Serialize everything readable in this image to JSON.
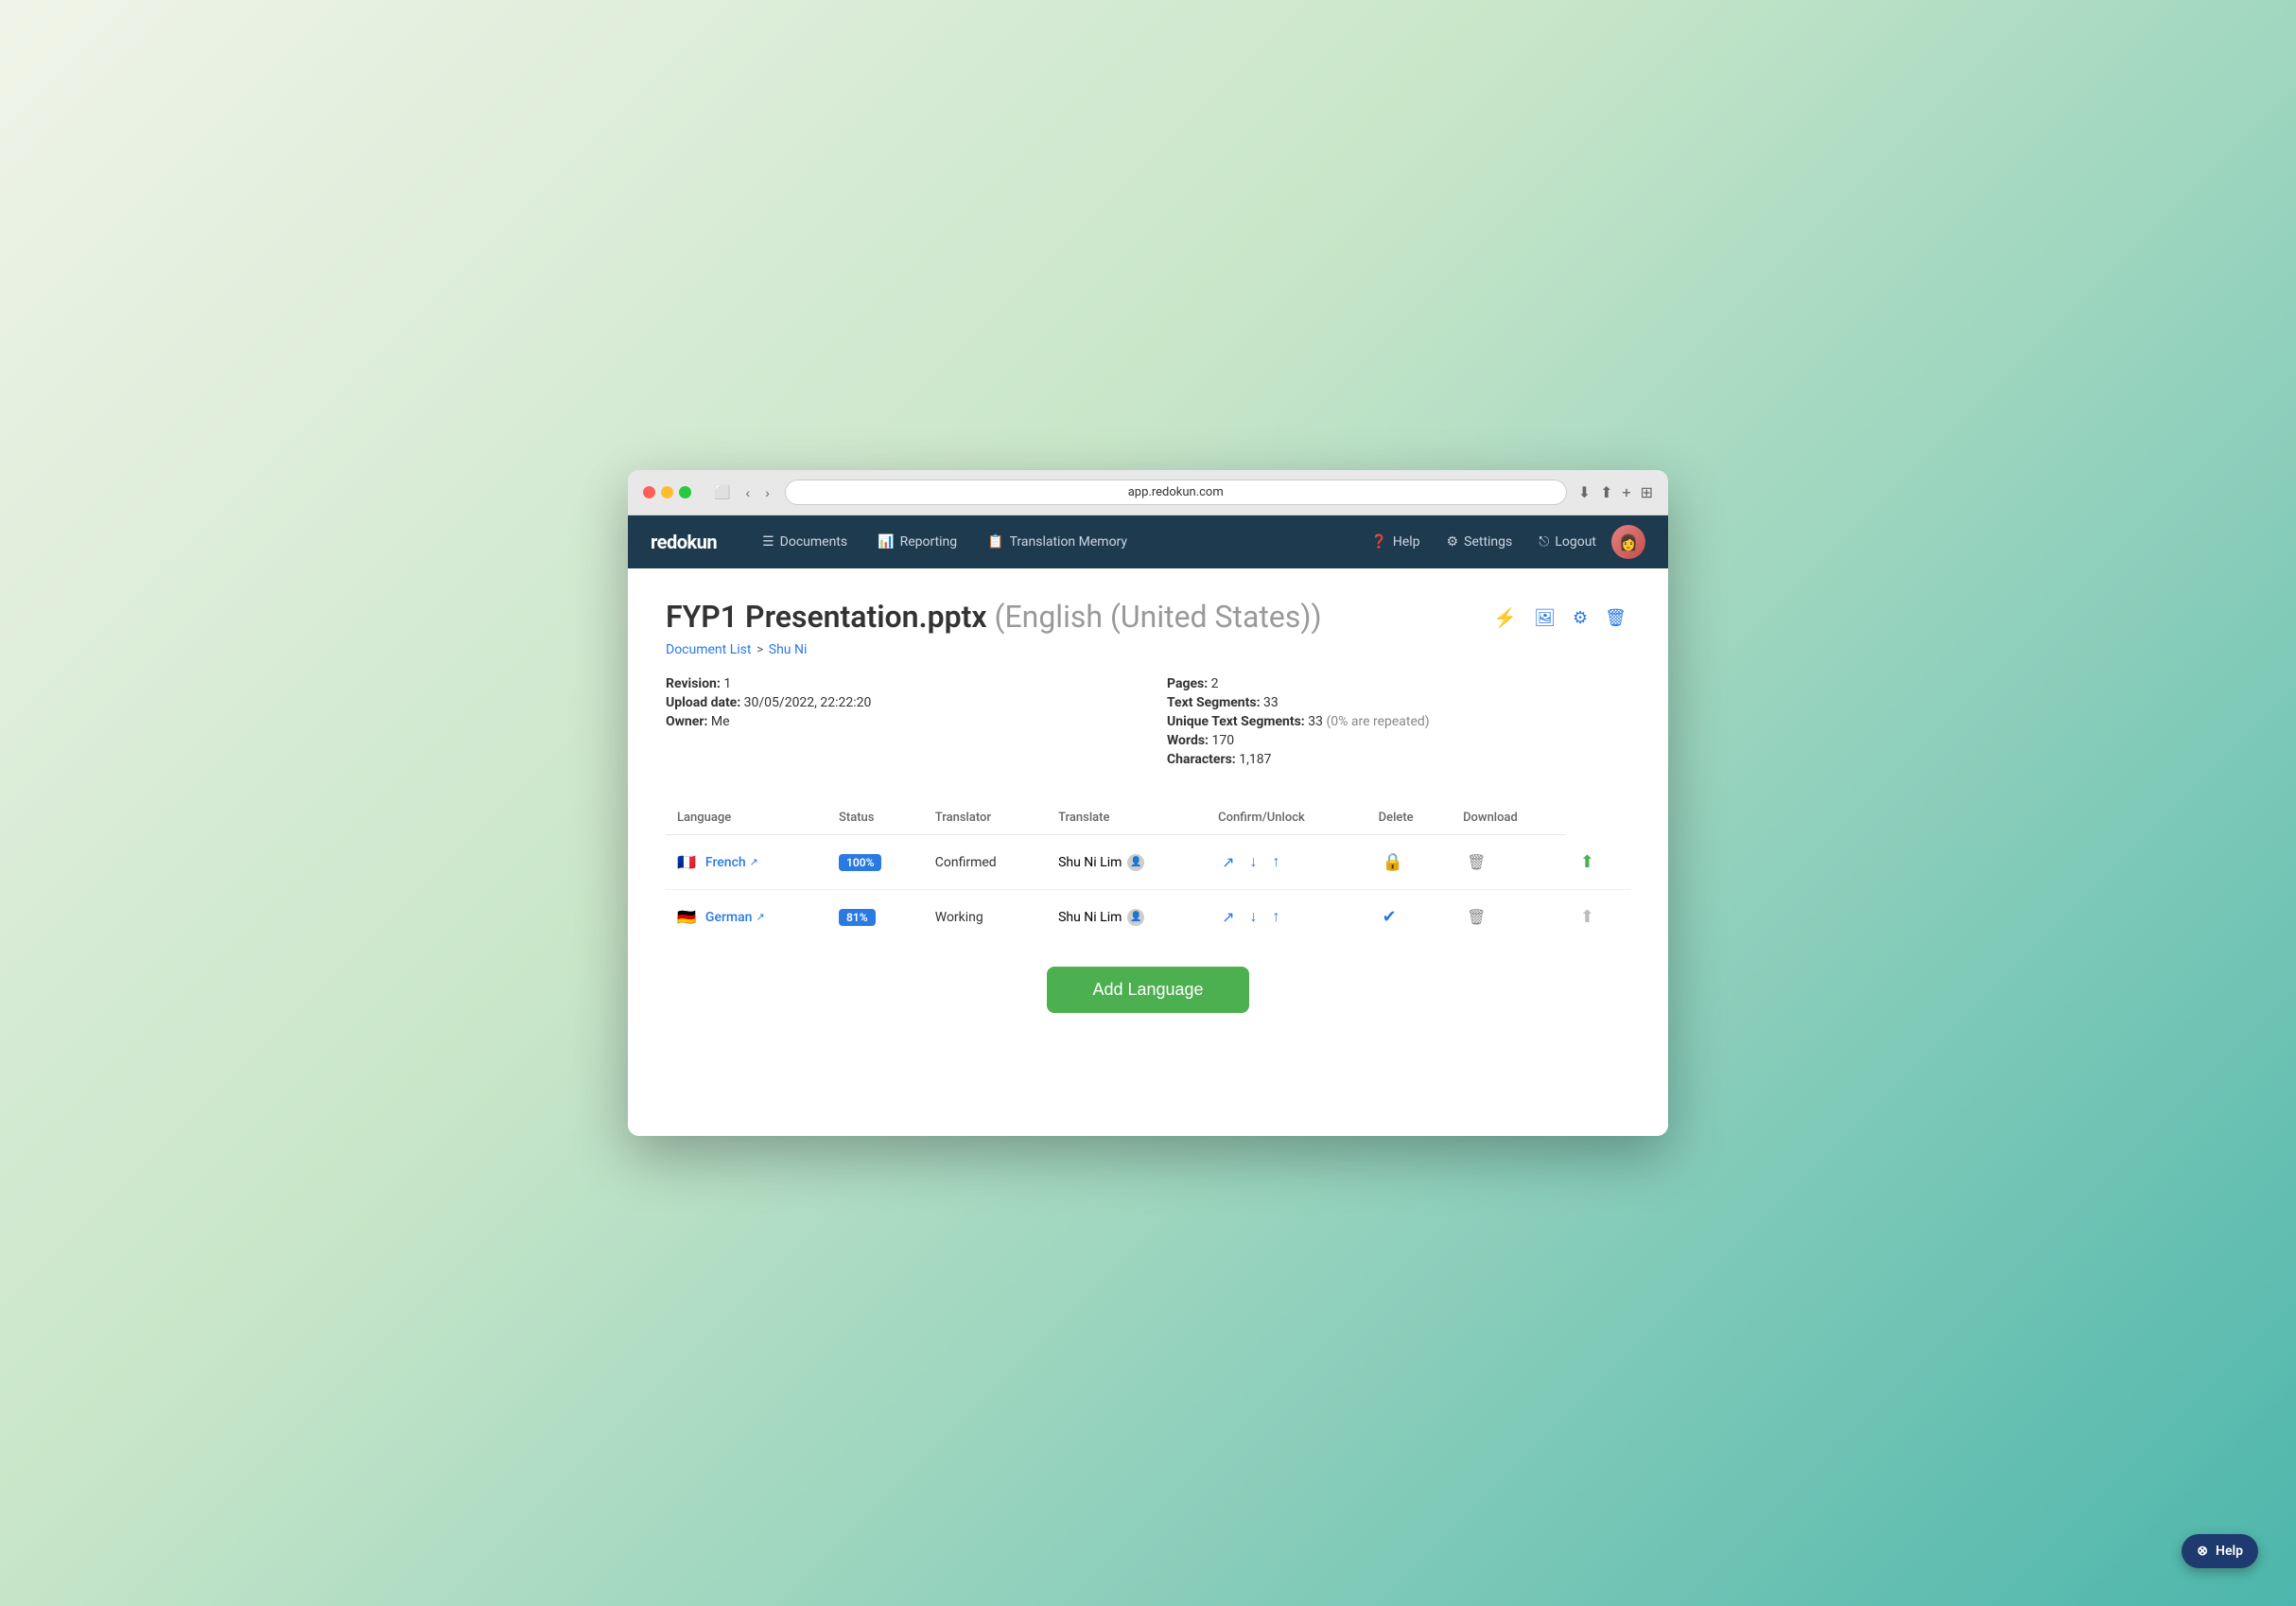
{
  "browser": {
    "address": "app.redokun.com"
  },
  "navbar": {
    "logo": "redokun",
    "nav_items": [
      {
        "id": "documents",
        "icon": "☰",
        "label": "Documents"
      },
      {
        "id": "reporting",
        "icon": "📊",
        "label": "Reporting"
      },
      {
        "id": "translation_memory",
        "icon": "📋",
        "label": "Translation Memory"
      }
    ],
    "right_items": [
      {
        "id": "help",
        "icon": "❓",
        "label": "Help"
      },
      {
        "id": "settings",
        "icon": "⚙",
        "label": "Settings"
      },
      {
        "id": "logout",
        "icon": "→",
        "label": "Logout"
      }
    ]
  },
  "page": {
    "title": "FYP1 Presentation.pptx",
    "title_secondary": "(English (United States))",
    "breadcrumb_list": "Document List",
    "breadcrumb_current": "Shu Ni",
    "actions": {
      "bolt": "⚡",
      "image": "🖼",
      "gear": "⚙",
      "trash": "🗑"
    }
  },
  "metadata": {
    "revision_label": "Revision:",
    "revision_value": "1",
    "upload_date_label": "Upload date:",
    "upload_date_value": "30/05/2022, 22:22:20",
    "owner_label": "Owner:",
    "owner_value": "Me",
    "pages_label": "Pages:",
    "pages_value": "2",
    "text_segments_label": "Text Segments:",
    "text_segments_value": "33",
    "unique_text_segments_label": "Unique Text Segments:",
    "unique_text_segments_value": "33",
    "unique_text_segments_note": "(0% are repeated)",
    "words_label": "Words:",
    "words_value": "170",
    "characters_label": "Characters:",
    "characters_value": "1,187"
  },
  "table": {
    "headers": {
      "language": "Language",
      "status": "Status",
      "translator": "Translator",
      "translate": "Translate",
      "confirm_unlock": "Confirm/Unlock",
      "delete": "Delete",
      "download": "Download"
    },
    "rows": [
      {
        "id": "french",
        "flag": "🇫🇷",
        "language": "French",
        "badge": "100%",
        "status": "Confirmed",
        "translator": "Shu Ni Lim",
        "translate_icons": [
          "↗",
          "↓",
          "↑"
        ],
        "confirm_icon": "lock",
        "delete_icon": "trash",
        "download_icon": "upload_green"
      },
      {
        "id": "german",
        "flag": "🇩🇪",
        "language": "German",
        "badge": "81%",
        "status": "Working",
        "translator": "Shu Ni Lim",
        "translate_icons": [
          "↗",
          "↓",
          "↑"
        ],
        "confirm_icon": "check",
        "delete_icon": "trash",
        "download_icon": "upload_gray"
      }
    ]
  },
  "add_language_btn": "Add Language",
  "help_btn": "Help"
}
